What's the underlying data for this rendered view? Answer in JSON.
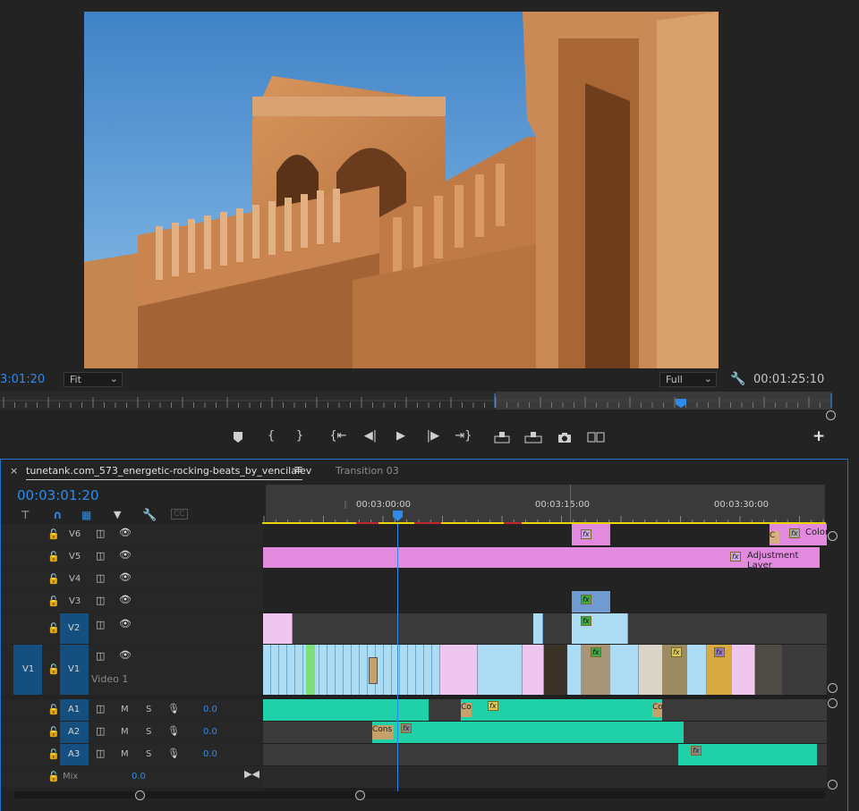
{
  "monitor": {
    "timecode_left": "3:01:20",
    "fit_label": "Fit",
    "quality_label": "Full",
    "timecode_right": "00:01:25:10"
  },
  "transport": {
    "icons": [
      "marker-icon",
      "in-point-icon",
      "out-point-icon",
      "go-to-in-icon",
      "step-back-icon",
      "play-icon",
      "step-forward-icon",
      "go-to-out-icon",
      "lift-icon",
      "extract-icon",
      "camera-icon",
      "compare-icon",
      "add-icon"
    ]
  },
  "timeline": {
    "tab_active": "tunetank.com_573_energetic-rocking-beats_by_vencilalev",
    "tab_menu": "≡",
    "tab_inactive": "Transition 03",
    "close_glyph": "×",
    "timecode": "00:03:01:20",
    "ruler_labels": [
      "00:03:00:00",
      "00:03:15:00",
      "00:03:30:00"
    ],
    "tracks": {
      "v6": "V6",
      "v5": "V5",
      "v4": "V4",
      "v3": "V3",
      "v2": "V2",
      "v1": "V1",
      "v1_src": "V1",
      "v1_name": "Video 1",
      "a1": "A1",
      "a2": "A2",
      "a3": "A3",
      "mix": "Mix",
      "a1_vol": "0.0",
      "a2_vol": "0.0",
      "a3_vol": "0.0",
      "mix_vol": "0.0",
      "m": "M",
      "s": "S"
    },
    "clips": {
      "color_label": "Color",
      "adjustment_label": "Adjustment Layer",
      "con1": "Co",
      "con2": "Cons",
      "con3": "Co",
      "c_small": "C",
      "fx": "fx"
    },
    "colors": {
      "accent_blue": "#2d8ceb",
      "video_clip": "#acdcf3",
      "adjustment_clip": "#e28ade",
      "audio_clip": "#1fd0a9"
    }
  }
}
